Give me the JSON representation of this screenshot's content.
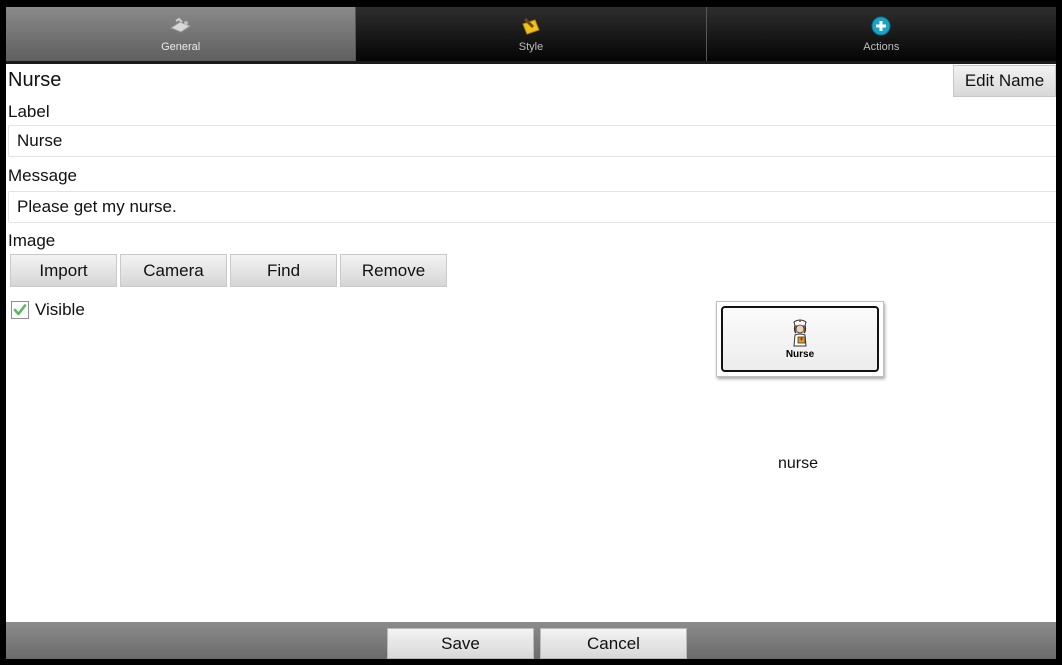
{
  "tabs": [
    {
      "label": "General",
      "icon": "general-icon",
      "active": true
    },
    {
      "label": "Style",
      "icon": "style-brush-icon",
      "active": false
    },
    {
      "label": "Actions",
      "icon": "add-circle-icon",
      "active": false
    }
  ],
  "header": {
    "title": "Nurse",
    "edit_name_label": "Edit Name"
  },
  "label_section": {
    "caption": "Label",
    "value": "Nurse"
  },
  "message_section": {
    "caption": "Message",
    "value": "Please get my nurse."
  },
  "image_section": {
    "caption": "Image",
    "buttons": {
      "import": "Import",
      "camera": "Camera",
      "find": "Find",
      "remove": "Remove"
    }
  },
  "visible": {
    "label": "Visible",
    "checked": true
  },
  "preview": {
    "label": "Nurse",
    "image_name": "nurse"
  },
  "footer": {
    "save": "Save",
    "cancel": "Cancel"
  },
  "colors": {
    "tab_active": "#7a7a7a",
    "tab_inactive": "#111111",
    "accent_add": "#1ba3c6",
    "check_green": "#5cb85c"
  }
}
